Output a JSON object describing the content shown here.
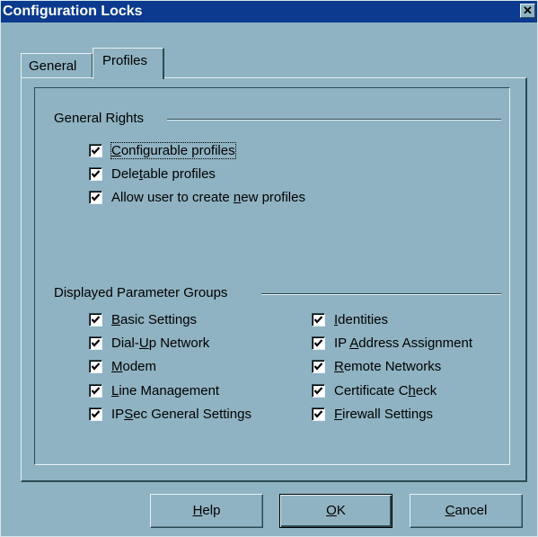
{
  "window": {
    "title": "Configuration Locks",
    "close_glyph": "✕"
  },
  "tabs": [
    {
      "label": "General",
      "selected": false
    },
    {
      "label": "Profiles",
      "selected": true
    }
  ],
  "general_rights": {
    "label": "General Rights",
    "items": [
      {
        "label_pre": "",
        "label_u": "C",
        "label_post": "onfigurable profiles",
        "checked": true,
        "focused": true
      },
      {
        "label_pre": "Dele",
        "label_u": "t",
        "label_post": "able profiles",
        "checked": true
      },
      {
        "label_pre": "Allow user to create ",
        "label_u": "n",
        "label_post": "ew profiles",
        "checked": true
      }
    ]
  },
  "param_groups": {
    "label": "Displayed Parameter Groups",
    "left": [
      {
        "label_pre": "",
        "label_u": "B",
        "label_post": "asic Settings",
        "checked": true
      },
      {
        "label_pre": "Dial-",
        "label_u": "U",
        "label_post": "p Network",
        "checked": true
      },
      {
        "label_pre": "",
        "label_u": "M",
        "label_post": "odem",
        "checked": true
      },
      {
        "label_pre": "",
        "label_u": "L",
        "label_post": "ine Management",
        "checked": true
      },
      {
        "label_pre": "IP",
        "label_u": "S",
        "label_post": "ec General Settings",
        "checked": true
      }
    ],
    "right": [
      {
        "label_pre": "",
        "label_u": "I",
        "label_post": "dentities",
        "checked": true
      },
      {
        "label_pre": "IP ",
        "label_u": "A",
        "label_post": "ddress Assignment",
        "checked": true
      },
      {
        "label_pre": "",
        "label_u": "R",
        "label_post": "emote Networks",
        "checked": true
      },
      {
        "label_pre": "Certificate C",
        "label_u": "h",
        "label_post": "eck",
        "checked": true
      },
      {
        "label_pre": "",
        "label_u": "F",
        "label_post": "irewall Settings",
        "checked": true
      }
    ]
  },
  "buttons": {
    "help": {
      "label_u": "H",
      "label_post": "elp"
    },
    "ok": {
      "label_u": "O",
      "label_post": "K"
    },
    "cancel": {
      "label_u": "C",
      "label_post": "ancel"
    }
  }
}
